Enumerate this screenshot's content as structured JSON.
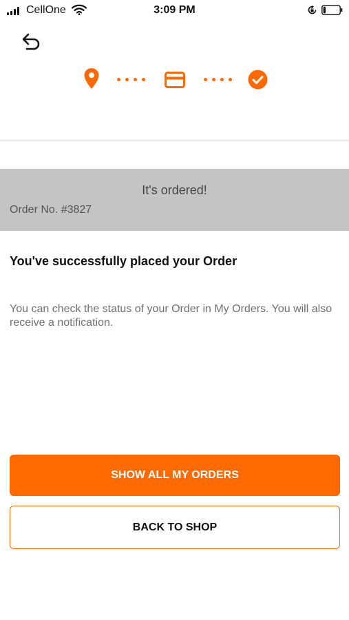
{
  "status_bar": {
    "carrier": "CellOne",
    "time": "3:09 PM",
    "signal_bars": 4,
    "battery_level": 0.15
  },
  "icons": {
    "back": "back-arrow-icon",
    "location": "location-pin-icon",
    "payment": "credit-card-icon",
    "confirmation": "check-circle-icon",
    "wifi": "wifi-icon",
    "rotation_lock": "rotation-lock-icon",
    "battery": "battery-icon"
  },
  "colors": {
    "accent": "#ff6a00",
    "banner_background": "#c4c4c4",
    "text_primary": "#111111",
    "text_secondary": "#707070"
  },
  "banner": {
    "title": "It's ordered!",
    "order_number": "Order No. #3827"
  },
  "content": {
    "heading": "You've successfully placed your Order",
    "info": "You can check the status of your Order in My Orders. You will also receive a notification."
  },
  "buttons": {
    "show_orders": "SHOW ALL MY ORDERS",
    "back_to_shop": "BACK TO SHOP"
  }
}
